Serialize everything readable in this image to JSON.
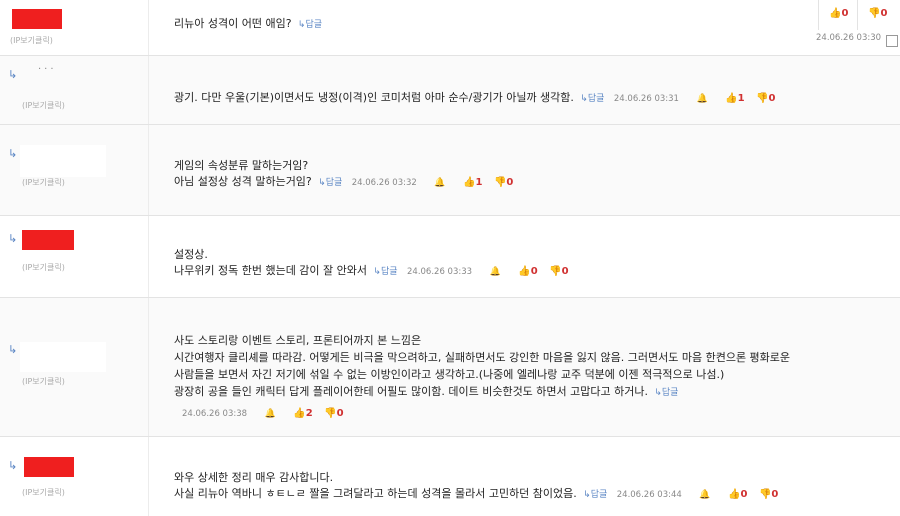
{
  "common": {
    "ip_label": "(IP보기클릭)",
    "reply_label": "답글",
    "reply_icon": "reply-arrow-icon",
    "like_icon": "thumbs-up-icon",
    "dislike_icon": "thumbs-down-icon",
    "report_icon": "bell-icon",
    "nested_icon": "reply-indent-arrow-icon"
  },
  "colors": {
    "accent": "#5b86c4",
    "vote_count": "#d03030",
    "redaction": "#ef1f1f"
  },
  "comments": [
    {
      "text_lines": [
        "리뉴아 성격이 어떤 애임?"
      ],
      "date": "24.06.26 03:30",
      "likes": "0",
      "dislikes": "0"
    },
    {
      "text_lines": [
        "광기. 다만 우울(기본)이면서도 냉정(이격)인 코미처럼 아마 순수/광기가 아닐까 생각함."
      ],
      "date": "24.06.26 03:31",
      "likes": "1",
      "dislikes": "0"
    },
    {
      "text_lines": [
        "게임의 속성분류 말하는거임?",
        "아님 설정상 성격 말하는거임?"
      ],
      "date": "24.06.26 03:32",
      "likes": "1",
      "dislikes": "0"
    },
    {
      "text_lines": [
        "설정상.",
        "나무위키 정독 한번 했는데 감이 잘 안와서"
      ],
      "date": "24.06.26 03:33",
      "likes": "0",
      "dislikes": "0"
    },
    {
      "text_lines": [
        "사도 스토리랑 이벤트 스토리, 프론티어까지 본 느낌은",
        "시간여행자 클리셰를 따라감. 어떻게든 비극을 막으려하고, 실패하면서도 강인한 마음을 잃지 않음. 그러면서도 마음 한켠으론 평화로운",
        "사람들을 보면서 자긴 저기에 섞일 수 없는 이방인이라고 생각하고.(나중에 엘레나랑 교주 덕분에 이젠 적극적으로 나섬.)",
        "광장히 공을 들인 캐릭터 답게 플레이어한테 어필도 많이함. 데이트 비슷한것도 하면서 고맙다고 하거나."
      ],
      "date": "24.06.26 03:38",
      "likes": "2",
      "dislikes": "0"
    },
    {
      "text_lines": [
        "와우 상세한 정리 매우 감사합니다.",
        "사실 리뉴아 역바니 ㅎㅌㄴㄹ 짤을 그려달라고 하는데 성격을 몰라서 고민하던 참이었음."
      ],
      "date": "24.06.26 03:44",
      "likes": "0",
      "dislikes": "0"
    }
  ]
}
